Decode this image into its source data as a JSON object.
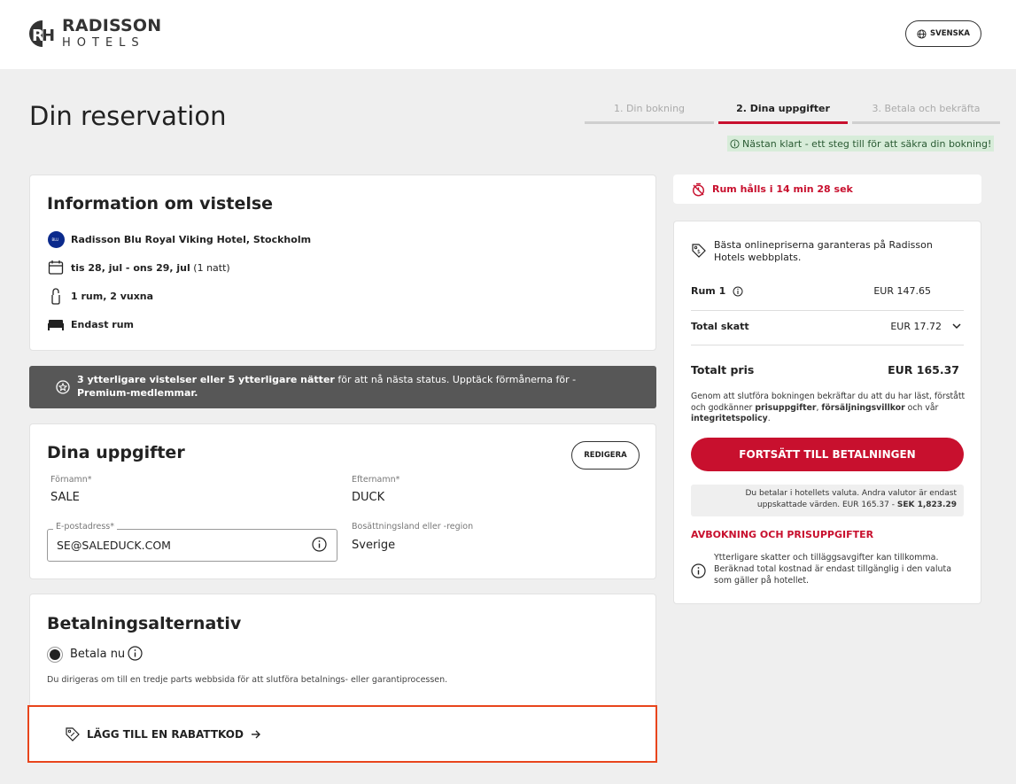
{
  "header": {
    "logo_line1": "RADISSON",
    "logo_line2": "HOTELS",
    "language_label": "SVENSKA"
  },
  "page": {
    "title": "Din reservation"
  },
  "steps": [
    {
      "label": "1. Din bokning",
      "active": false
    },
    {
      "label": "2. Dina uppgifter",
      "active": true
    },
    {
      "label": "3. Betala och bekräfta",
      "active": false
    }
  ],
  "notice": "Nästan klart - ett steg till för att säkra din bokning!",
  "stay_info": {
    "title": "Information om vistelse",
    "hotel": "Radisson Blu Royal Viking Hotel, Stockholm",
    "dates": "tis 28, jul - ons 29, jul",
    "nights": "(1 natt)",
    "guests": "1 rum, 2 vuxna",
    "board": "Endast rum"
  },
  "status_banner": {
    "bold_part": "3 ytterligare vistelser eller 5 ytterligare nätter",
    "normal_part": " för att nå nästa status. Upptäck förmånerna för - ",
    "bold_end": "Premium-medlemmar."
  },
  "details": {
    "title": "Dina uppgifter",
    "edit_label": "REDIGERA",
    "first_name_label": "Förnamn*",
    "first_name": "SALE",
    "last_name_label": "Efternamn*",
    "last_name": "DUCK",
    "email_label": "E-postadress*",
    "email": "SE@SALEDUCK.COM",
    "country_label": "Bosättningsland eller -region",
    "country": "Sverige"
  },
  "payment": {
    "title": "Betalningsalternativ",
    "option_label": "Betala nu",
    "note": "Du dirigeras om till en tredje parts webbsida för att slutföra betalnings- eller garantiprocessen.",
    "promo_label": "LÄGG TILL EN RABATTKOD"
  },
  "hold": {
    "text": "Rum hålls i 14 min 28 sek"
  },
  "summary": {
    "best_price": "Bästa onlinepriserna garanteras på Radisson Hotels webbplats.",
    "room_label": "Rum 1",
    "room_price": "EUR 147.65",
    "tax_label": "Total skatt",
    "tax_value": "EUR 17.72",
    "total_label": "Totalt pris",
    "total_value": "EUR 165.37",
    "terms_1": "Genom att slutföra bokningen bekräftar du att du har läst, förstått och godkänner ",
    "terms_b1": "prisuppgifter",
    "terms_2": ", ",
    "terms_b2": "försäljningsvillkor",
    "terms_3": " och vår ",
    "terms_b3": "integritetspolicy",
    "terms_4": ".",
    "cta_label": "FORTSÄTT TILL BETALNINGEN",
    "currency_note": "Du betalar i hotellets valuta. Andra valutor är endast uppskattade värden. EUR 165.37 - ",
    "currency_sek": "SEK 1,823.29",
    "cancel_link": "AVBOKNING OCH PRISUPPGIFTER",
    "tax_note": "Ytterligare skatter och tilläggsavgifter kan tillkomma. Beräknad total kostnad är endast tillgänglig i den valuta som gäller på hotellet."
  },
  "colors": {
    "brand_red": "#c8102e",
    "highlight_orange": "#e8451c",
    "banner_gray": "#575757",
    "notice_green": "#d7ecd9"
  }
}
